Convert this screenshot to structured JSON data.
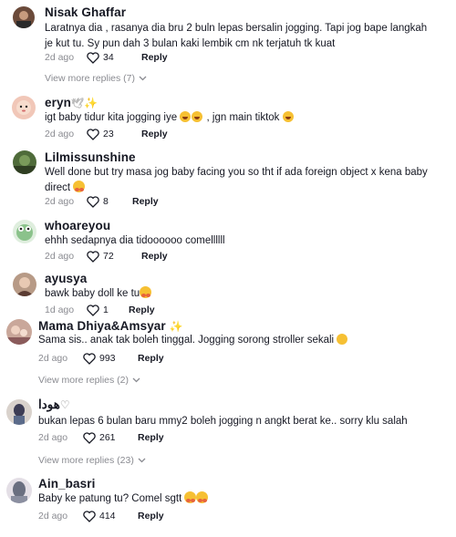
{
  "comments": [
    {
      "username": "Nisak Ghaffar",
      "text": "Laratnya dia , rasanya dia bru 2 buln lepas bersalin jogging. Tapi jog bape langkah je kut tu. Sy pun dah 3 bulan kaki lembik cm nk terjatuh tk kuat",
      "time": "2d ago",
      "likes": "34",
      "reply": "Reply",
      "more": "View more replies (7)"
    },
    {
      "username": "eryn",
      "text": "igt baby tidur kita jogging iye",
      "text_after": ", jgn main tiktok",
      "time": "2d ago",
      "likes": "23",
      "reply": "Reply"
    },
    {
      "username": "Lilmissunshine",
      "text": "Well done but try masa jog baby facing you so tht if ada foreign object x kena baby direct",
      "time": "2d ago",
      "likes": "8",
      "reply": "Reply"
    },
    {
      "username": "whoareyou",
      "text": "ehhh sedapnya dia tidoooooo comellllll",
      "time": "2d ago",
      "likes": "72",
      "reply": "Reply"
    },
    {
      "username": "ayusya",
      "text": "bawk baby doll ke tu",
      "time": "1d ago",
      "likes": "1",
      "reply": "Reply"
    },
    {
      "username": "Mama Dhiya&Amsyar",
      "text": "Sama sis.. anak tak boleh tinggal. Jogging sorong stroller sekali",
      "time": "2d ago",
      "likes": "993",
      "reply": "Reply",
      "more": "View more replies (2)"
    },
    {
      "username": "هودا",
      "text": "bukan lepas 6 bulan baru mmy2 boleh jogging n angkt berat ke.. sorry klu salah",
      "time": "2d ago",
      "likes": "261",
      "reply": "Reply",
      "more": "View more replies (23)"
    },
    {
      "username": "Ain_basri",
      "text": "Baby ke patung tu? Comel sgtt",
      "time": "2d ago",
      "likes": "414",
      "reply": "Reply"
    }
  ],
  "icons": {
    "like": "heart-outline-icon",
    "expand": "chevron-down-icon"
  },
  "colors": {
    "text": "#161823",
    "muted": "#8a8b91"
  }
}
